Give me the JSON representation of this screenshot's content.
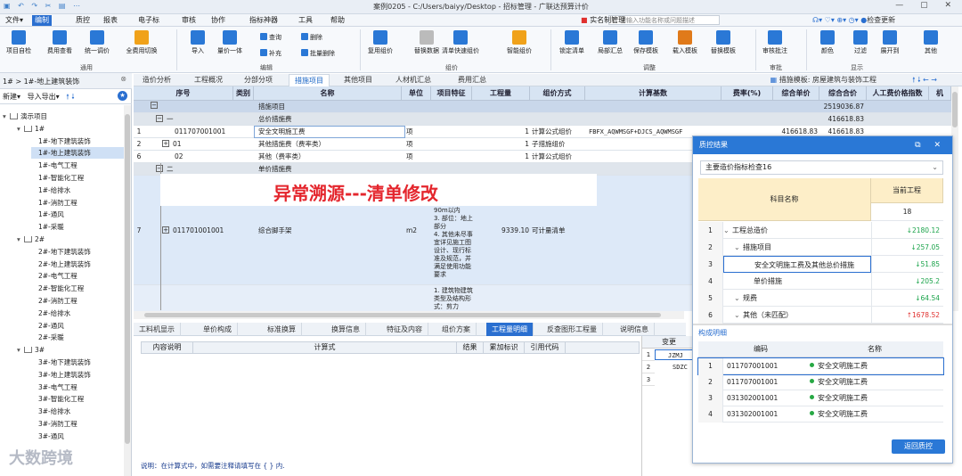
{
  "title": "案例0205 - C:/Users/baiyy/Desktop - 招标管理 - 广联达预算计价",
  "menu": [
    "文件▾",
    "编制",
    "报表",
    "报表",
    "电子标",
    "审核",
    "协作",
    "指标神器",
    "工具",
    "帮助"
  ],
  "menu_real": [
    "文件▾",
    "编制",
    "质控",
    "报表",
    "电子标",
    "审核",
    "协作",
    "指标神器",
    "工具",
    "帮助"
  ],
  "quick_right": {
    "realname": "实名制管理",
    "search_placeholder": "请输入功能名称或问题描述",
    "update": "检查更新"
  },
  "ribbon": {
    "btns": [
      {
        "label": "项目自检",
        "color": "#2a78d6"
      },
      {
        "label": "费用查看",
        "color": "#2a78d6"
      },
      {
        "label": "统一调价",
        "color": "#2a78d6"
      },
      {
        "label": "全费用切换",
        "color": "#f0a21a"
      },
      {
        "label": "导入",
        "color": "#2a78d6"
      },
      {
        "label": "量价一体",
        "color": "#2a78d6"
      },
      {
        "label": "复用组价",
        "color": "#2a78d6"
      },
      {
        "label": "替换数据",
        "color": "#bbb"
      },
      {
        "label": "清单快速组价",
        "color": "#2a78d6"
      },
      {
        "label": "智能组价",
        "color": "#f0a21a"
      },
      {
        "label": "锁定清单",
        "color": "#2a78d6"
      },
      {
        "label": "局部汇总",
        "color": "#2a78d6"
      },
      {
        "label": "保存模板",
        "color": "#2a78d6"
      },
      {
        "label": "载入模板",
        "color": "#e07a1a"
      },
      {
        "label": "替换模板",
        "color": "#2a78d6"
      },
      {
        "label": "审核批注",
        "color": "#2a78d6"
      },
      {
        "label": "颜色",
        "color": "#2a78d6"
      },
      {
        "label": "过滤",
        "color": "#2a78d6"
      },
      {
        "label": "展开到",
        "color": "#2a78d6"
      },
      {
        "label": "其他",
        "color": "#2a78d6"
      }
    ],
    "small": [
      "查询",
      "补充",
      "删除",
      "批量删除"
    ],
    "groups": [
      "通用",
      "编辑",
      "组价",
      "调整",
      "审批",
      "显示"
    ]
  },
  "left": {
    "breadcrumb": "1# > 1#-地上建筑装饰",
    "new": "新建",
    "import_export": "导入导出",
    "tree": [
      {
        "t": "演示项目",
        "lvl": 0,
        "k": "root"
      },
      {
        "t": "1#",
        "lvl": 1,
        "k": "node"
      },
      {
        "t": "1#-地下建筑装饰",
        "lvl": 2,
        "k": "leaf"
      },
      {
        "t": "1#-地上建筑装饰",
        "lvl": 2,
        "k": "leaf",
        "sel": true
      },
      {
        "t": "1#-电气工程",
        "lvl": 2,
        "k": "leaf"
      },
      {
        "t": "1#-智能化工程",
        "lvl": 2,
        "k": "leaf"
      },
      {
        "t": "1#-给排水",
        "lvl": 2,
        "k": "leaf"
      },
      {
        "t": "1#-消防工程",
        "lvl": 2,
        "k": "leaf"
      },
      {
        "t": "1#-通风",
        "lvl": 2,
        "k": "leaf"
      },
      {
        "t": "1#-采暖",
        "lvl": 2,
        "k": "leaf"
      },
      {
        "t": "2#",
        "lvl": 1,
        "k": "node"
      },
      {
        "t": "2#-地下建筑装饰",
        "lvl": 2,
        "k": "leaf"
      },
      {
        "t": "2#-地上建筑装饰",
        "lvl": 2,
        "k": "leaf"
      },
      {
        "t": "2#-电气工程",
        "lvl": 2,
        "k": "leaf"
      },
      {
        "t": "2#-智能化工程",
        "lvl": 2,
        "k": "leaf"
      },
      {
        "t": "2#-消防工程",
        "lvl": 2,
        "k": "leaf"
      },
      {
        "t": "2#-给排水",
        "lvl": 2,
        "k": "leaf"
      },
      {
        "t": "2#-通风",
        "lvl": 2,
        "k": "leaf"
      },
      {
        "t": "2#-采暖",
        "lvl": 2,
        "k": "leaf"
      },
      {
        "t": "3#",
        "lvl": 1,
        "k": "node"
      },
      {
        "t": "3#-地下建筑装饰",
        "lvl": 2,
        "k": "leaf"
      },
      {
        "t": "3#-地上建筑装饰",
        "lvl": 2,
        "k": "leaf"
      },
      {
        "t": "3#-电气工程",
        "lvl": 2,
        "k": "leaf"
      },
      {
        "t": "3#-智能化工程",
        "lvl": 2,
        "k": "leaf"
      },
      {
        "t": "3#-给排水",
        "lvl": 2,
        "k": "leaf"
      },
      {
        "t": "3#-消防工程",
        "lvl": 2,
        "k": "leaf"
      },
      {
        "t": "3#-通风",
        "lvl": 2,
        "k": "leaf"
      }
    ]
  },
  "tabs": [
    "造价分析",
    "工程概况",
    "分部分项",
    "措施项目",
    "其他项目",
    "人材机汇总",
    "费用汇总"
  ],
  "tabs_active": 3,
  "tab_right": "措施模板: 房屋建筑与装饰工程",
  "grid": {
    "headers": [
      "序号",
      "类别",
      "名称",
      "单位",
      "项目特征",
      "工程量",
      "组价方式",
      "计算基数",
      "费率(%)",
      "综合单价",
      "综合合价",
      "人工费价格指数",
      "机"
    ],
    "rows": [
      {
        "seq": "",
        "code": "",
        "name": "措施项目",
        "unit": "",
        "qty": "",
        "method": "",
        "base": "",
        "rate": "",
        "price": "",
        "total": "2519036.87",
        "kind": "head"
      },
      {
        "seq": "",
        "code": "一",
        "name": "总价措施费",
        "unit": "",
        "qty": "",
        "method": "",
        "base": "",
        "rate": "",
        "price": "",
        "total": "416618.83",
        "kind": "grp"
      },
      {
        "seq": "1",
        "code": "011707001001",
        "name": "安全文明施工费",
        "unit": "项",
        "qty": "1",
        "method": "计算公式组价",
        "base": "FBFX_AQWMSGF+DJCS_AQWMSGF",
        "rate": "",
        "price": "416618.83",
        "total": "416618.83",
        "kind": "row"
      },
      {
        "seq": "2",
        "code": "01",
        "name": "其他措施费（费率类）",
        "unit": "项",
        "qty": "1",
        "method": "子措施组价",
        "base": "",
        "rate": "",
        "price": "",
        "total": "",
        "kind": "row"
      },
      {
        "seq": "6",
        "code": "02",
        "name": "其他（费率类）",
        "unit": "项",
        "qty": "1",
        "method": "计算公式组价",
        "base": "",
        "rate": "",
        "price": "",
        "total": "",
        "kind": "row"
      },
      {
        "seq": "",
        "code": "二",
        "name": "单价措施费",
        "unit": "",
        "qty": "",
        "method": "",
        "base": "",
        "rate": "",
        "price": "",
        "total": "",
        "kind": "grp"
      },
      {
        "seq": "7",
        "code": "011701001001",
        "name": "综合脚手架",
        "unit": "m2",
        "qty": "9339.10",
        "method": "可计量清单",
        "base": "",
        "rate": "",
        "price": "",
        "total": "",
        "kind": "big",
        "feat": "90m以内\n3. 部位：地上部分\n4. 其他未尽事宜详见施工图设计、现行标准及规范，并满足使用功能要求"
      },
      {
        "seq": "",
        "code": "",
        "name": "",
        "unit": "",
        "qty": "",
        "method": "",
        "base": "",
        "rate": "",
        "price": "",
        "total": "",
        "kind": "tail",
        "feat": "1. 建筑物建筑类型及结构形式：剪力"
      }
    ]
  },
  "banner": "异常溯源---清单修改",
  "bottom_tabs": [
    "工料机显示",
    "单价构成",
    "标准换算",
    "换算信息",
    "特征及内容",
    "组价方案",
    "工程量明细",
    "反查图形工程量",
    "说明信息"
  ],
  "bottom_tabs_active": 6,
  "bottom_headers": [
    "内容说明",
    "计算式",
    "结果",
    "累加标识",
    "引用代码"
  ],
  "note": "说明：在计算式中，如需要注释请填写在 { } 内.",
  "rightmini": {
    "header": "变更",
    "r1": "JZMJ",
    "r2": "SDZC",
    "rows": [
      "1",
      "2",
      "3"
    ]
  },
  "dialog": {
    "title": "质控结果",
    "select": "主要造价指标检查16",
    "col_name": "科目名称",
    "col_cur": "当前工程",
    "col_cur_sub": "18",
    "items": [
      {
        "i": "1",
        "name": "工程总造价",
        "ind": 0,
        "val": "2180.12",
        "dir": "dn"
      },
      {
        "i": "2",
        "name": "措施项目",
        "ind": 1,
        "val": "257.05",
        "dir": "dn"
      },
      {
        "i": "3",
        "name": "安全文明施工费及其他总价措施",
        "ind": 2,
        "val": "51.85",
        "dir": "dn"
      },
      {
        "i": "4",
        "name": "单价措施",
        "ind": 2,
        "val": "205.2",
        "dir": "dn"
      },
      {
        "i": "5",
        "name": "规费",
        "ind": 1,
        "val": "64.54",
        "dir": "dn"
      },
      {
        "i": "6",
        "name": "其他（未匹配）",
        "ind": 1,
        "val": "1678.52",
        "dir": "up"
      }
    ],
    "sub_label": "构成明细",
    "sub_headers": [
      "编码",
      "名称"
    ],
    "sub_items": [
      {
        "i": "1",
        "code": "011707001001",
        "name": "安全文明施工费"
      },
      {
        "i": "2",
        "code": "011707001001",
        "name": "安全文明施工费"
      },
      {
        "i": "3",
        "code": "031302001001",
        "name": "安全文明施工费"
      },
      {
        "i": "4",
        "code": "031302001001",
        "name": "安全文明施工费"
      }
    ],
    "button": "返回质控"
  },
  "watermark": "大数跨境"
}
